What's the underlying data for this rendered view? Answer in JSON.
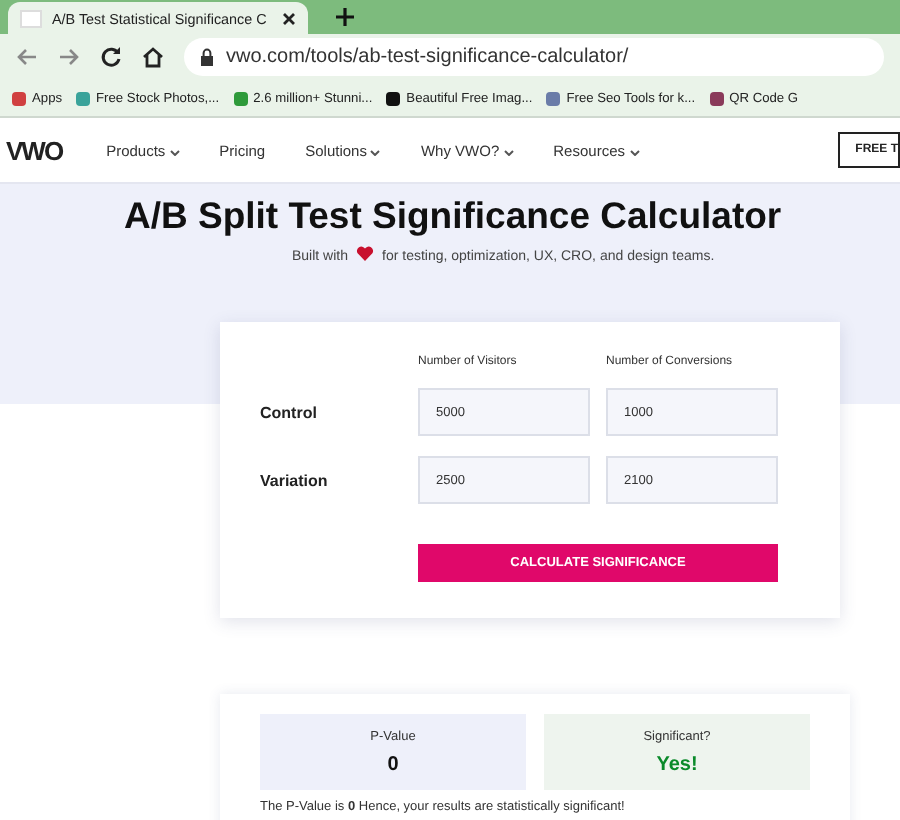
{
  "browser": {
    "tab_title": "A/B Test Statistical Significance C",
    "url": "vwo.com/tools/ab-test-significance-calculator/",
    "bookmarks": [
      {
        "label": "Apps",
        "color": "#d04040"
      },
      {
        "label": "Free Stock Photos,...",
        "color": "#3aa39a"
      },
      {
        "label": "2.6 million+ Stunni...",
        "color": "#2e9a3a"
      },
      {
        "label": "Beautiful Free Imag...",
        "color": "#111111"
      },
      {
        "label": "Free Seo Tools for k...",
        "color": "#6a7ca8"
      },
      {
        "label": "QR Code G",
        "color": "#8a3a5a"
      }
    ]
  },
  "nav": {
    "logo": "VWO",
    "items": [
      {
        "label": "Products",
        "dropdown": true
      },
      {
        "label": "Pricing",
        "dropdown": false
      },
      {
        "label": "Solutions",
        "dropdown": true
      },
      {
        "label": "Why VWO?",
        "dropdown": true
      },
      {
        "label": "Resources",
        "dropdown": true
      }
    ],
    "cta": "FREE T"
  },
  "hero": {
    "title": "A/B Split Test Significance Calculator",
    "subtitle_before": "Built with",
    "subtitle_after": "for testing, optimization, UX, CRO, and design teams."
  },
  "calculator": {
    "columns": [
      "Number of Visitors",
      "Number of Conversions"
    ],
    "rows": [
      {
        "label": "Control",
        "values": [
          "5000",
          "1000"
        ]
      },
      {
        "label": "Variation",
        "values": [
          "2500",
          "2100"
        ]
      }
    ],
    "button": "CALCULATE SIGNIFICANCE"
  },
  "results": {
    "cards": [
      {
        "label": "P-Value",
        "value": "0",
        "kind": "neutral"
      },
      {
        "label": "Significant?",
        "value": "Yes!",
        "kind": "positive"
      }
    ],
    "summary": "The P-Value is **0** Hence, your results are statistically significant!"
  }
}
